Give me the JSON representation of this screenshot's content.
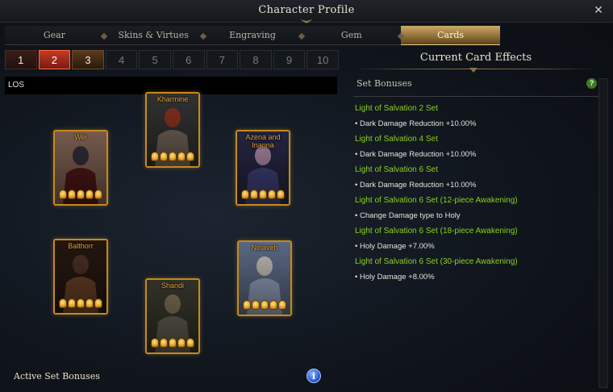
{
  "window": {
    "title": "Character Profile",
    "close_icon": "close-icon"
  },
  "tabs": [
    {
      "label": "Gear",
      "active": false
    },
    {
      "label": "Skins & Virtues",
      "active": false
    },
    {
      "label": "Engraving",
      "active": false
    },
    {
      "label": "Gem",
      "active": false
    },
    {
      "label": "Cards",
      "active": true
    }
  ],
  "deck_pages": [
    "1",
    "2",
    "3",
    "4",
    "5",
    "6",
    "7",
    "8",
    "9",
    "10"
  ],
  "selected_page": "2",
  "deck_name": "LOS",
  "cards": [
    {
      "name": "Wei",
      "awakening": 5,
      "palette": [
        "#5a1a1a",
        "#2a2a3a",
        "#8a6a5a"
      ]
    },
    {
      "name": "Kharmine",
      "awakening": 5,
      "palette": [
        "#8a7a6a",
        "#aa3a20",
        "#3a3a3a"
      ]
    },
    {
      "name": "Azena and Inanna",
      "awakening": 5,
      "palette": [
        "#4a4a8a",
        "#c8a0c0",
        "#2a2a4a"
      ]
    },
    {
      "name": "Balthorr",
      "awakening": 5,
      "palette": [
        "#7a4a2a",
        "#5a3a2a",
        "#2a1a14"
      ]
    },
    {
      "name": "Shandi",
      "awakening": 5,
      "palette": [
        "#6a6a5a",
        "#8a7a5a",
        "#3a3a30"
      ]
    },
    {
      "name": "Ninaveh",
      "awakening": 5,
      "palette": [
        "#aab8d8",
        "#e8e0d0",
        "#6a7a9a"
      ]
    }
  ],
  "footer": {
    "active_set_label": "Active Set Bonuses",
    "info_icon": "info-icon",
    "info_glyph": "i"
  },
  "effects": {
    "title": "Current Card Effects",
    "section": "Set Bonuses",
    "help_icon": "question-icon",
    "help_glyph": "?",
    "bonuses": [
      {
        "title": "Light of Salvation 2 Set",
        "effect": "• Dark Damage Reduction +10.00%"
      },
      {
        "title": "Light of Salvation 4 Set",
        "effect": "• Dark Damage Reduction +10.00%"
      },
      {
        "title": "Light of Salvation 6 Set",
        "effect": "• Dark Damage Reduction +10.00%"
      },
      {
        "title": "Light of Salvation 6 Set (12-piece Awakening)",
        "effect": "• Change Damage type to Holy"
      },
      {
        "title": "Light of Salvation 6 Set (18-piece Awakening)",
        "effect": "• Holy Damage +7.00%"
      },
      {
        "title": "Light of Salvation 6 Set (30-piece Awakening)",
        "effect": "• Holy Damage +8.00%"
      }
    ]
  },
  "colors": {
    "accent": "#c58a1c",
    "bonus_green": "#8cd01e",
    "selected_page": "#c23a22"
  }
}
